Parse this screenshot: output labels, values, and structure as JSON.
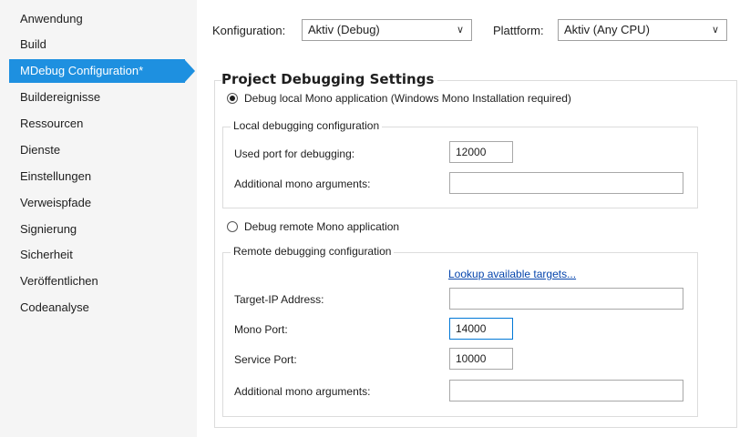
{
  "sidebar": {
    "items": [
      {
        "label": "Anwendung"
      },
      {
        "label": "Build"
      },
      {
        "label": "MDebug Configuration*"
      },
      {
        "label": "Buildereignisse"
      },
      {
        "label": "Ressourcen"
      },
      {
        "label": "Dienste"
      },
      {
        "label": "Einstellungen"
      },
      {
        "label": "Verweispfade"
      },
      {
        "label": "Signierung"
      },
      {
        "label": "Sicherheit"
      },
      {
        "label": "Veröffentlichen"
      },
      {
        "label": "Codeanalyse"
      }
    ],
    "active_index": 2
  },
  "header": {
    "configuration_label": "Konfiguration:",
    "configuration_value": "Aktiv (Debug)",
    "platform_label": "Plattform:",
    "platform_value": "Aktiv (Any CPU)"
  },
  "panel": {
    "title": "Project Debugging Settings",
    "local_radio_label": "Debug local Mono application (Windows Mono Installation required)",
    "local_radio_checked": true,
    "local_group": {
      "title": "Local debugging configuration",
      "port_label": "Used port for debugging:",
      "port_value": "12000",
      "args_label": "Additional mono arguments:",
      "args_value": ""
    },
    "remote_radio_label": "Debug remote Mono application",
    "remote_radio_checked": false,
    "remote_group": {
      "title": "Remote debugging configuration",
      "lookup_link": "Lookup available targets...",
      "ip_label": "Target-IP Address:",
      "ip_value": "",
      "mono_port_label": "Mono Port:",
      "mono_port_value": "14000",
      "service_port_label": "Service Port:",
      "service_port_value": "10000",
      "args_label": "Additional mono arguments:",
      "args_value": ""
    }
  },
  "colors": {
    "accent": "#1e90e0",
    "link": "#0645ad",
    "focus_border": "#0078d7"
  }
}
